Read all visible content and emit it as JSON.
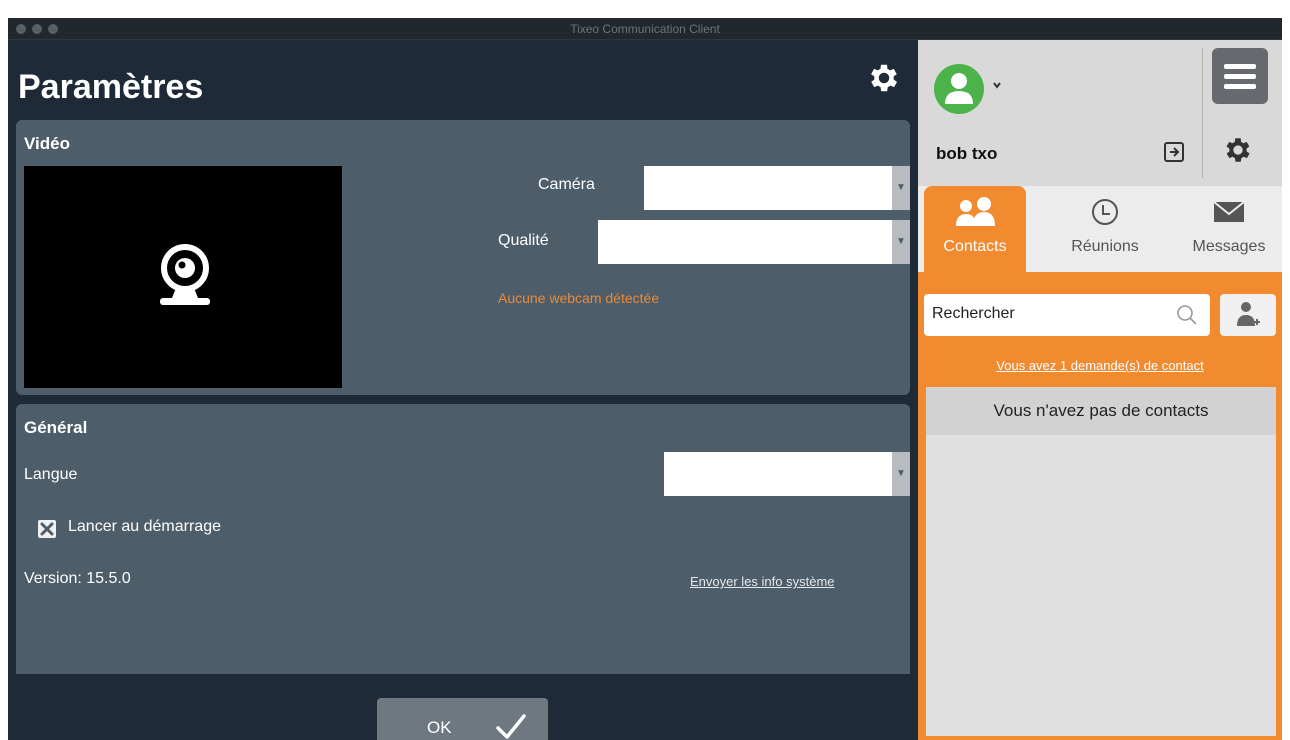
{
  "window": {
    "title": "Tixeo Communication Client"
  },
  "settings": {
    "title": "Paramètres",
    "video": {
      "heading": "Vidéo",
      "camera_label": "Caméra",
      "camera_value": "",
      "quality_label": "Qualité",
      "quality_value": "",
      "warning": "Aucune webcam détectée"
    },
    "general": {
      "heading": "Général",
      "language_label": "Langue",
      "language_value": "",
      "launch_at_startup_label": "Lancer au démarrage",
      "launch_at_startup_checked": true,
      "version": "Version: 15.5.0",
      "send_system_info_link": "Envoyer les info système"
    },
    "ok_label": "OK"
  },
  "sidebar": {
    "username": "bob txo",
    "status_color": "#4cb24a",
    "accent_color": "#f28a30",
    "tabs": [
      {
        "label": "Contacts",
        "icon": "contacts-icon",
        "active": true
      },
      {
        "label": "Réunions",
        "icon": "clock-icon",
        "active": false
      },
      {
        "label": "Messages",
        "icon": "envelope-icon",
        "active": false
      }
    ],
    "search_placeholder": "Rechercher",
    "contact_request_link": "Vous avez 1 demande(s) de contact",
    "empty_contacts": "Vous n'avez pas de contacts"
  }
}
